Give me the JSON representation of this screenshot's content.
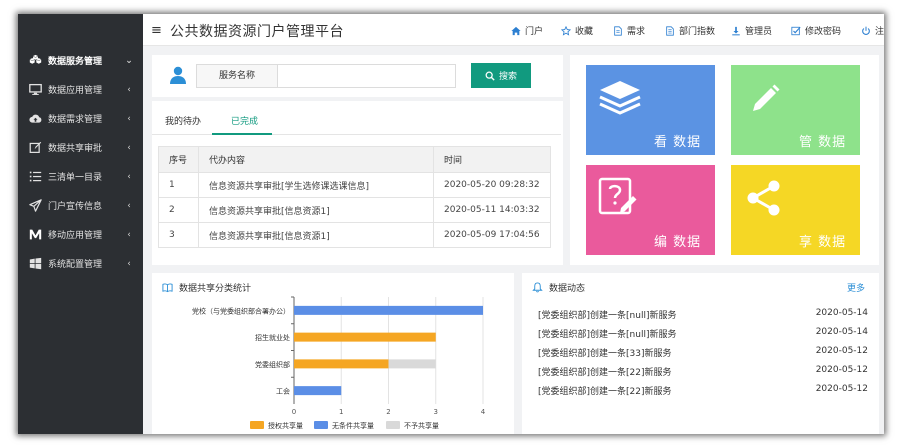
{
  "sidebar": {
    "items": [
      {
        "label": "数据服务管理",
        "icon": "cubes-icon",
        "chevron": "⌄",
        "active": true
      },
      {
        "label": "数据应用管理",
        "icon": "monitor-icon",
        "chevron": "‹",
        "active": false
      },
      {
        "label": "数据需求管理",
        "icon": "cloud-upload-icon",
        "chevron": "‹",
        "active": false
      },
      {
        "label": "数据共享审批",
        "icon": "edit-icon",
        "chevron": "‹",
        "active": false
      },
      {
        "label": "三清单一目录",
        "icon": "list-icon",
        "chevron": "‹",
        "active": false
      },
      {
        "label": "门户宣传信息",
        "icon": "paper-plane-icon",
        "chevron": "‹",
        "active": false
      },
      {
        "label": "移动应用管理",
        "icon": "m-letter-icon",
        "chevron": "‹",
        "active": false
      },
      {
        "label": "系统配置管理",
        "icon": "windows-icon",
        "chevron": "‹",
        "active": false
      }
    ]
  },
  "header": {
    "title": "公共数据资源门户管理平台",
    "nav": [
      {
        "label": "门户",
        "icon": "home-icon"
      },
      {
        "label": "收藏",
        "icon": "star-icon"
      },
      {
        "label": "需求",
        "icon": "file-icon"
      },
      {
        "label": "部门指数",
        "icon": "document-icon"
      },
      {
        "label": "管理员",
        "icon": "download-icon"
      },
      {
        "label": "修改密码",
        "icon": "check-square-icon"
      },
      {
        "label": "注销",
        "icon": "power-icon"
      }
    ]
  },
  "search": {
    "label": "服务名称",
    "value": "",
    "placeholder": "",
    "button_label": "搜索"
  },
  "tasks": {
    "tabs": [
      {
        "label": "我的待办",
        "active": false
      },
      {
        "label": "已完成",
        "active": true
      }
    ],
    "columns": [
      "序号",
      "代办内容",
      "时间"
    ],
    "rows": [
      [
        "1",
        "信息资源共享审批[学生选修课选课信息]",
        "2020-05-20 09:28:32"
      ],
      [
        "2",
        "信息资源共享审批[信息资源1]",
        "2020-05-11 14:03:32"
      ],
      [
        "3",
        "信息资源共享审批[信息资源1]",
        "2020-05-09 17:04:56"
      ]
    ]
  },
  "tiles": [
    {
      "label": "看 数据",
      "icon": "layers-icon",
      "color": "#5b93e3"
    },
    {
      "label": "管 数据",
      "icon": "pencil-icon",
      "color": "#8ee28b"
    },
    {
      "label": "编 数据",
      "icon": "edit-document-icon",
      "color": "#ea5a9c"
    },
    {
      "label": "享 数据",
      "icon": "share-icon",
      "color": "#f5d725"
    }
  ],
  "share_stats": {
    "title": "数据共享分类统计",
    "icon": "book-open-icon"
  },
  "news": {
    "title": "数据动态",
    "icon": "bell-icon",
    "more_label": "更多",
    "items": [
      {
        "text": "[党委组织部]创建一条[null]新服务",
        "date": "2020-05-14"
      },
      {
        "text": "[党委组织部]创建一条[null]新服务",
        "date": "2020-05-14"
      },
      {
        "text": "[党委组织部]创建一条[33]新服务",
        "date": "2020-05-12"
      },
      {
        "text": "[党委组织部]创建一条[22]新服务",
        "date": "2020-05-12"
      },
      {
        "text": "[党委组织部]创建一条[22]新服务",
        "date": "2020-05-12"
      }
    ]
  },
  "chart_data": {
    "type": "bar",
    "orientation": "horizontal",
    "stacked": true,
    "categories": [
      "党校（与党委组织部合署办公）",
      "招生就业处",
      "党委组织部",
      "工会"
    ],
    "series": [
      {
        "name": "授权共享量",
        "color": "#f5a623",
        "values": [
          0,
          3,
          2,
          0
        ]
      },
      {
        "name": "无条件共享量",
        "color": "#5b8ee6",
        "values": [
          4,
          0,
          0,
          1
        ]
      },
      {
        "name": "不予共享量",
        "color": "#d9d9d9",
        "values": [
          0,
          0,
          1,
          0
        ]
      }
    ],
    "xticks": [
      "0",
      "1",
      "2",
      "3",
      "4"
    ],
    "xlim": [
      0,
      4
    ],
    "legend": "bottom",
    "grid": true
  }
}
